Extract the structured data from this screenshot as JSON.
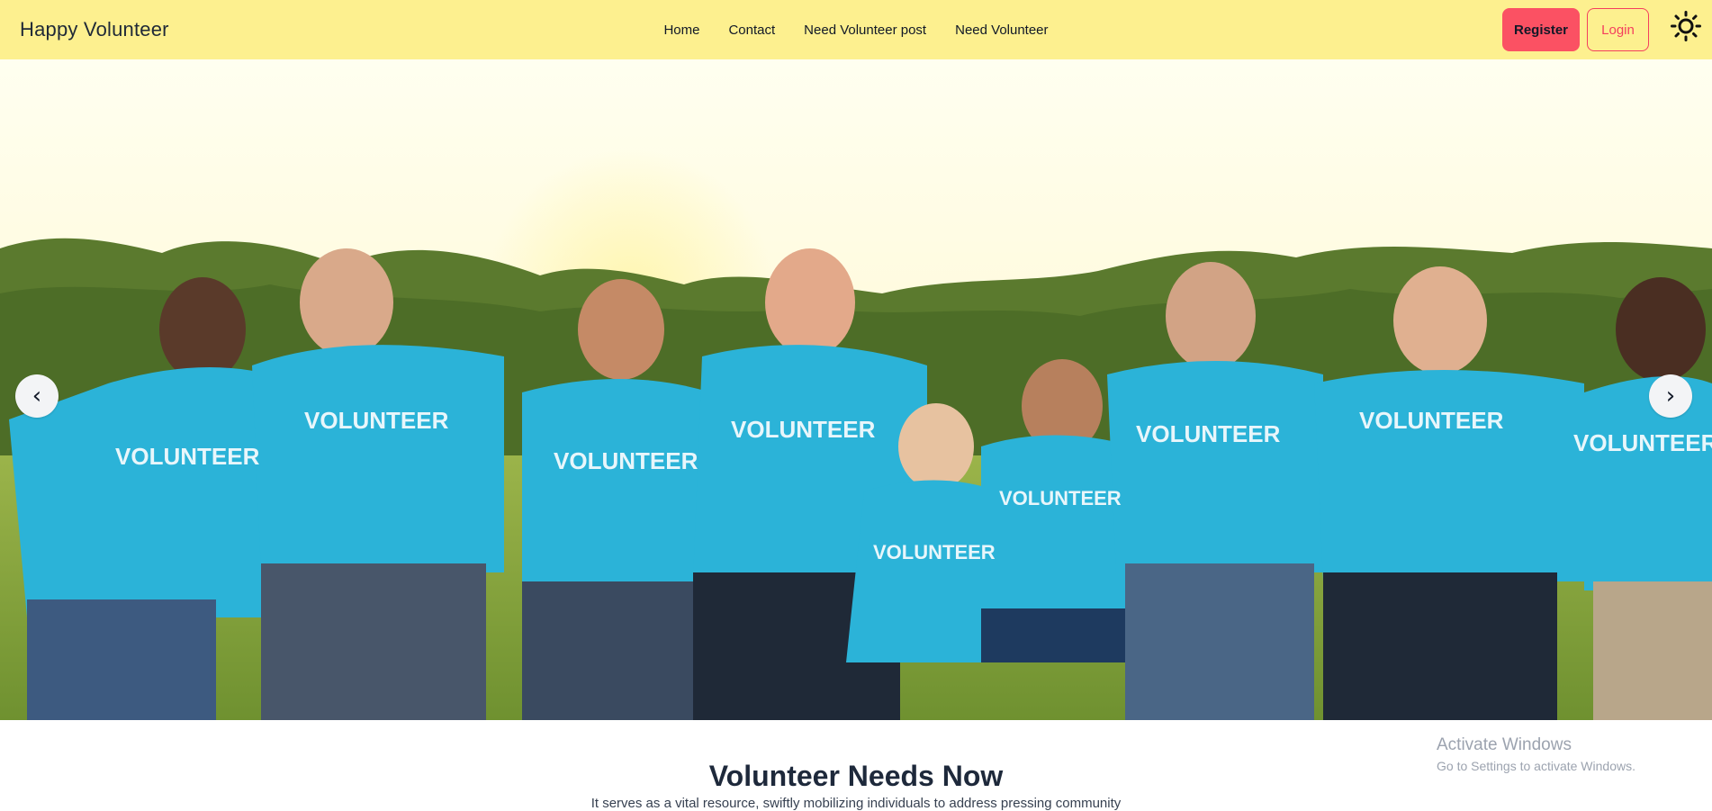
{
  "navbar": {
    "brand": "Happy Volunteer",
    "links": [
      "Home",
      "Contact",
      "Need Volunteer post",
      "Need Volunteer"
    ],
    "register_label": "Register",
    "login_label": "Login",
    "theme_icon": "sun-icon"
  },
  "hero": {
    "prev_label": "‹",
    "next_label": "›",
    "shirt_text": "VOLUNTEER"
  },
  "section": {
    "title": "Volunteer Needs Now",
    "description": "It serves as a vital resource, swiftly mobilizing individuals to address pressing community"
  },
  "watermark": {
    "title": "Activate Windows",
    "subtitle": "Go to Settings to activate Windows."
  },
  "colors": {
    "navbar_bg": "#fdf08f",
    "register_bg": "#fb5163",
    "login_border": "#f43f5e",
    "shirt": "#2bb3d8",
    "grass": "#7d9f3a"
  }
}
